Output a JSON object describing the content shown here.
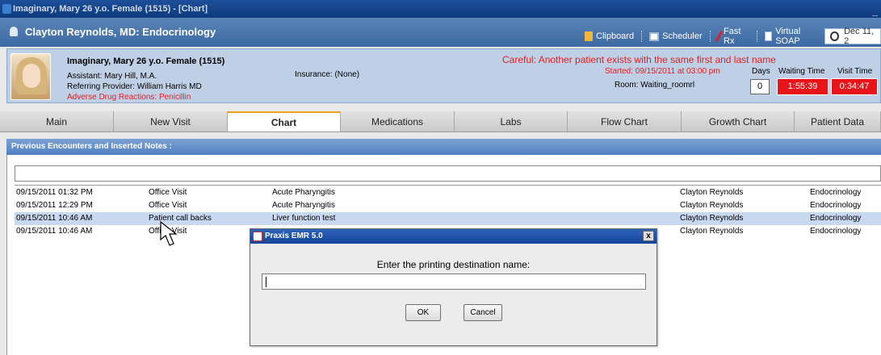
{
  "window": {
    "title": "Imaginary, Mary 26 y.o. Female (1515) - [Chart]"
  },
  "provider": {
    "name": "Clayton Reynolds, MD: Endocrinology"
  },
  "toolbar": {
    "clipboard": "Clipboard",
    "scheduler": "Scheduler",
    "fast_rx": "Fast Rx",
    "virtual_soap": "Virtual SOAP",
    "date": "Dec 11, 2"
  },
  "patient": {
    "name": "Imaginary, Mary 26 y.o. Female (1515)",
    "assistant": "Assistant: Mary Hill, M.A.",
    "referring": "Referring Provider: William Harris MD",
    "adr": "Adverse Drug Reactions: Penicillin",
    "insurance": "Insurance: (None)",
    "warning": "Careful: Another patient exists with the same first and last name",
    "started": "Started: 09/15/2011 at 03:00 pm",
    "room": "Room: Waiting_roomrl",
    "days_label": "Days",
    "days_value": "0",
    "waiting_label": "Waiting Time",
    "waiting_value": "1:55:39",
    "visit_label": "Visit Time",
    "visit_value": "0:34:47"
  },
  "tabs": [
    "Main",
    "New Visit",
    "Chart",
    "Medications",
    "Labs",
    "Flow Chart",
    "Growth Chart",
    "Patient Data"
  ],
  "section": {
    "title": "Previous Encounters and Inserted Notes :"
  },
  "encounters": [
    {
      "date": "09/15/2011 01:32 PM",
      "type": "Office Visit",
      "desc": "Acute Pharyngitis",
      "provider": "Clayton Reynolds",
      "specialty": "Endocrinology"
    },
    {
      "date": "09/15/2011 12:29 PM",
      "type": "Office Visit",
      "desc": "Acute Pharyngitis",
      "provider": "Clayton Reynolds",
      "specialty": "Endocrinology"
    },
    {
      "date": "09/15/2011 10:46 AM",
      "type": "Patient call backs",
      "desc": "Liver function test",
      "provider": "Clayton Reynolds",
      "specialty": "Endocrinology"
    },
    {
      "date": "09/15/2011 10:46 AM",
      "type": "Office Visit",
      "desc": "",
      "provider": "Clayton Reynolds",
      "specialty": "Endocrinology"
    }
  ],
  "dialog": {
    "title": "Praxis EMR 5.0",
    "close": "x",
    "prompt": "Enter the printing destination name:",
    "input_value": "",
    "ok": "OK",
    "cancel": "Cancel"
  }
}
